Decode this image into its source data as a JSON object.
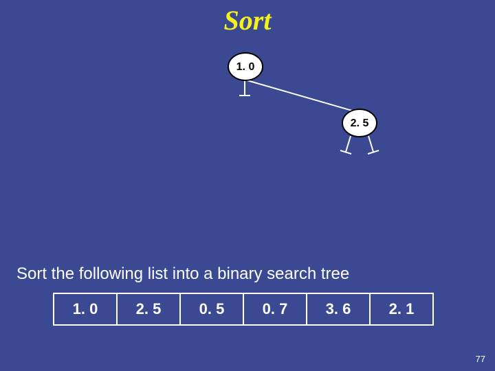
{
  "title": "Sort",
  "prompt": "Sort the following list into a binary search tree",
  "page_number": "77",
  "tree": {
    "root_value": "1. 0",
    "right_child_value": "2. 5"
  },
  "input_list": [
    "1. 0",
    "2. 5",
    "0. 5",
    "0. 7",
    "3. 6",
    "2. 1"
  ]
}
